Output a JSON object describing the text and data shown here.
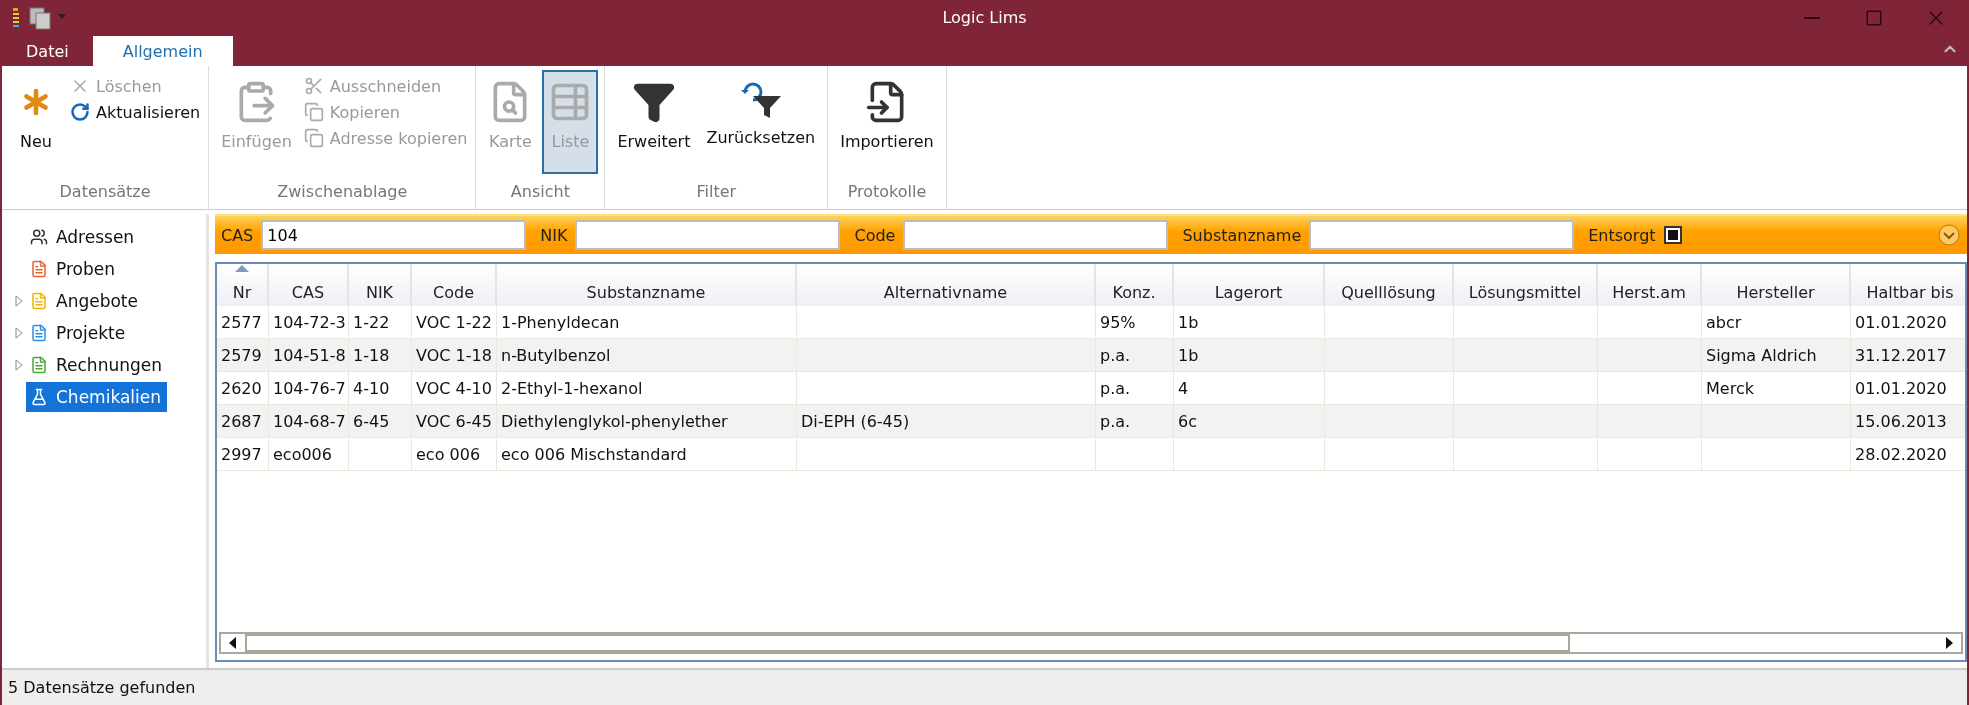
{
  "window": {
    "title": "Logic Lims"
  },
  "tabs": [
    {
      "label": "Datei",
      "selected": false
    },
    {
      "label": "Allgemein",
      "selected": true
    }
  ],
  "ribbon": {
    "groups": [
      {
        "label": "Datensätze",
        "items": [
          {
            "label": "Neu",
            "kind": "large",
            "disabled": false
          },
          {
            "label": "Löschen",
            "kind": "small",
            "disabled": true
          },
          {
            "label": "Aktualisieren",
            "kind": "small",
            "disabled": false
          }
        ]
      },
      {
        "label": "Zwischenablage",
        "items": [
          {
            "label": "Einfügen",
            "kind": "large",
            "disabled": true
          },
          {
            "label": "Ausschneiden",
            "kind": "small",
            "disabled": true
          },
          {
            "label": "Kopieren",
            "kind": "small",
            "disabled": true
          },
          {
            "label": "Adresse kopieren",
            "kind": "small",
            "disabled": true
          }
        ]
      },
      {
        "label": "Ansicht",
        "items": [
          {
            "label": "Karte",
            "kind": "large",
            "disabled": true,
            "selected": false
          },
          {
            "label": "Liste",
            "kind": "large",
            "disabled": true,
            "selected": true
          }
        ]
      },
      {
        "label": "Filter",
        "items": [
          {
            "label": "Erweitert",
            "kind": "large",
            "disabled": false
          },
          {
            "label": "Zurücksetzen",
            "kind": "large",
            "disabled": false
          }
        ]
      },
      {
        "label": "Protokolle",
        "items": [
          {
            "label": "Importieren",
            "kind": "large",
            "disabled": false
          }
        ]
      }
    ]
  },
  "sidebar": {
    "items": [
      {
        "label": "Adressen",
        "selected": false
      },
      {
        "label": "Proben",
        "color": "#e8622a",
        "selected": false
      },
      {
        "label": "Angebote",
        "color": "#f0b400",
        "expanded": false,
        "selected": false
      },
      {
        "label": "Projekte",
        "color": "#2a8ee8",
        "expanded": false,
        "selected": false
      },
      {
        "label": "Rechnungen",
        "color": "#4aa83a",
        "expanded": false,
        "selected": false
      },
      {
        "label": "Chemikalien",
        "selected": true
      }
    ]
  },
  "filter": {
    "fields": [
      {
        "label": "CAS",
        "value": "104"
      },
      {
        "label": "NIK"
      },
      {
        "label": "Code"
      },
      {
        "label": "Substanzname"
      }
    ],
    "checkbox": {
      "label": "Entsorgt",
      "checked": true
    }
  },
  "table": {
    "columns": [
      {
        "label": "Nr",
        "sorted": true
      },
      {
        "label": "CAS",
        "sorted": false
      },
      {
        "label": "NIK",
        "sorted": false
      },
      {
        "label": "Code",
        "sorted": false
      },
      {
        "label": "Substanzname",
        "sorted": false
      },
      {
        "label": "Alternativname",
        "sorted": false
      },
      {
        "label": "Konz.",
        "sorted": false
      },
      {
        "label": "Lagerort",
        "sorted": false
      },
      {
        "label": "Quelllösung",
        "sorted": false
      },
      {
        "label": "Lösungsmittel",
        "sorted": false
      },
      {
        "label": "Herst.am",
        "sorted": false
      },
      {
        "label": "Hersteller",
        "sorted": false
      },
      {
        "label": "Haltbar bis",
        "sorted": false
      }
    ],
    "rows": [
      [
        "2577",
        "104-72-3",
        "1-22",
        "VOC 1-22",
        "1-Phenyldecan",
        "",
        "95%",
        "1b",
        "",
        "",
        "",
        "abcr",
        "01.01.2020"
      ],
      [
        "2579",
        "104-51-8",
        "1-18",
        "VOC 1-18",
        "n-Butylbenzol",
        "",
        "p.a.",
        "1b",
        "",
        "",
        "",
        "Sigma Aldrich",
        "31.12.2017"
      ],
      [
        "2620",
        "104-76-7",
        "4-10",
        "VOC 4-10",
        "2-Ethyl-1-hexanol",
        "",
        "p.a.",
        "4",
        "",
        "",
        "",
        "Merck",
        "01.01.2020"
      ],
      [
        "2687",
        "104-68-7",
        "6-45",
        "VOC 6-45",
        "Diethylenglykol-phenylether",
        "Di-EPH  (6-45)",
        "p.a.",
        "6c",
        "",
        "",
        "",
        "",
        "15.06.2013"
      ],
      [
        "2997",
        "eco006",
        "",
        "eco 006",
        "eco 006 Mischstandard",
        "",
        "",
        "",
        "",
        "",
        "",
        "",
        "28.02.2020"
      ]
    ]
  },
  "status_bar": {
    "text": "5 Datensätze gefunden"
  }
}
